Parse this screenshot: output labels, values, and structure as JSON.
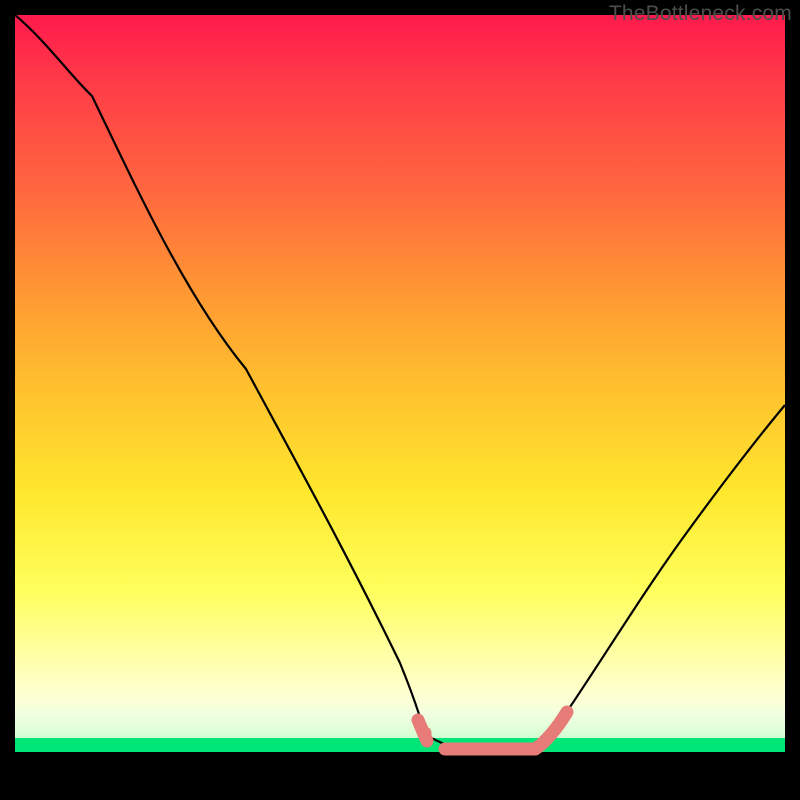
{
  "watermark": "TheBottleneck.com",
  "chart_data": {
    "type": "line",
    "title": "",
    "xlabel": "",
    "ylabel": "",
    "ylim": [
      0,
      100
    ],
    "x": [
      0.0,
      0.05,
      0.1,
      0.15,
      0.2,
      0.25,
      0.3,
      0.35,
      0.4,
      0.45,
      0.5,
      0.52,
      0.56,
      0.6,
      0.65,
      0.68,
      0.72,
      0.78,
      0.85,
      0.92,
      1.0
    ],
    "values": [
      100,
      96,
      89,
      81,
      72,
      62,
      52,
      42,
      32,
      22,
      12,
      5,
      1,
      0,
      0,
      1,
      4,
      10,
      20,
      32,
      47
    ],
    "flat_minimum": {
      "x_start": 0.56,
      "x_end": 0.68,
      "value": 0
    },
    "highlight_segments": [
      {
        "x_start": 0.52,
        "x_end": 0.54,
        "color": "#e77b78"
      },
      {
        "x_start": 0.55,
        "x_end": 0.68,
        "color": "#e77b78"
      },
      {
        "x_start": 0.68,
        "x_end": 0.72,
        "color": "#e77b78"
      }
    ],
    "colors": {
      "curve": "#000000",
      "highlight": "#e77b78",
      "gradient_top": "#ff1a4d",
      "gradient_bottom": "#00e676"
    }
  }
}
